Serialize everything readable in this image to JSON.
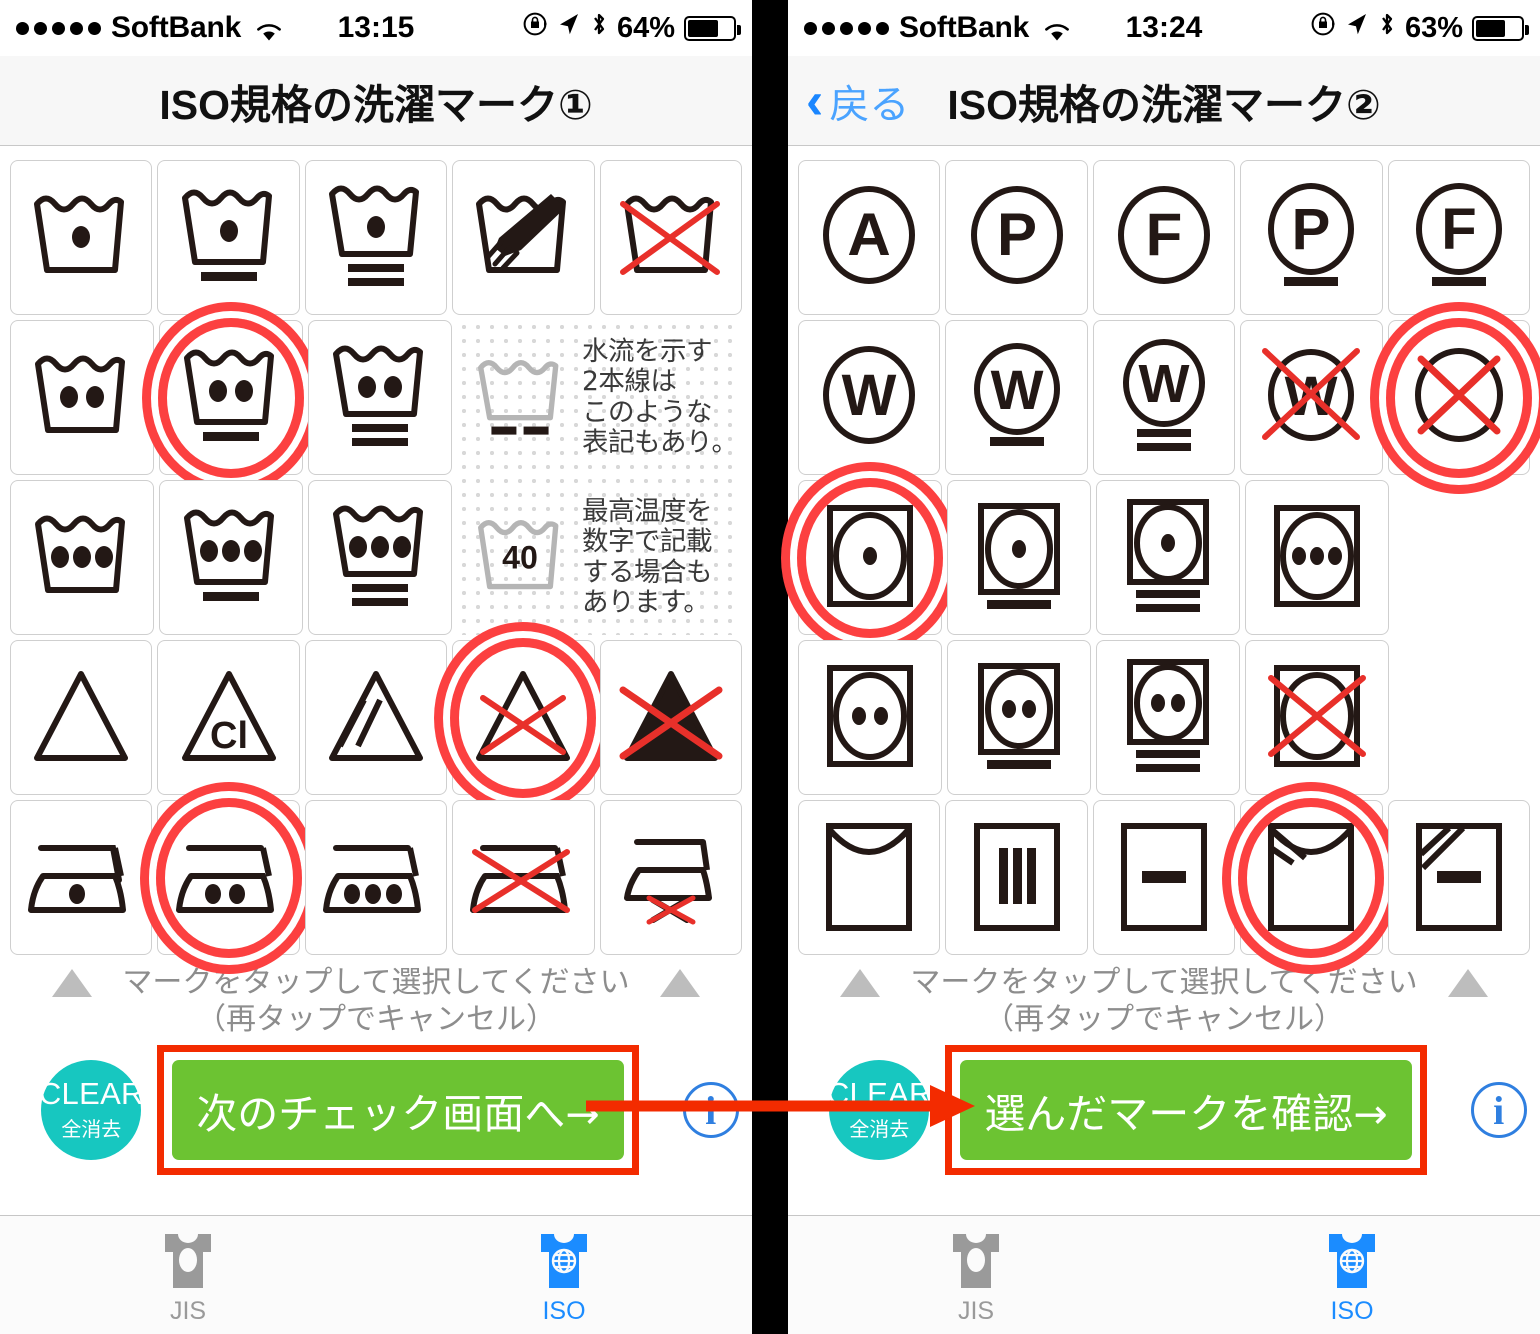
{
  "app": {
    "tabs": [
      {
        "id": "jis",
        "label": "JIS",
        "icon": "tshirt-icon",
        "active": false
      },
      {
        "id": "iso",
        "label": "ISO",
        "icon": "tshirt-globe-icon",
        "active": true
      }
    ],
    "colors": {
      "selection_ring": "#fc4040",
      "clear_button": "#17c7c0",
      "primary_button": "#6cc332",
      "highlight_box": "#f32b00",
      "active_tab": "#1b8cff",
      "inactive_tab": "#9a9a9a",
      "back_link": "#4aa3ff",
      "info_icon": "#2f7fe0"
    }
  },
  "screens": [
    {
      "id": "screen-1",
      "status_bar": {
        "signal_dots": 5,
        "carrier": "SoftBank",
        "wifi_icon": "wifi-icon",
        "time": "13:15",
        "lock_icon": "rotation-lock-icon",
        "location_icon": "location-arrow-icon",
        "bluetooth_icon": "bluetooth-icon",
        "battery_percent": "64%",
        "battery_level": 64
      },
      "nav": {
        "title": "ISO規格の洗濯マーク①",
        "has_back": false,
        "back_label": ""
      },
      "grid": {
        "rows": [
          {
            "cells": [
              {
                "name": "wash-normal-1dot",
                "icon": "wash-tub-1dot",
                "selected": false
              },
              {
                "name": "wash-mild-1dot",
                "icon": "wash-tub-1dot-1bar",
                "selected": false
              },
              {
                "name": "wash-very-mild-1dot",
                "icon": "wash-tub-1dot-2bar",
                "selected": false
              },
              {
                "name": "hand-wash",
                "icon": "wash-tub-hand",
                "selected": false
              },
              {
                "name": "do-not-wash",
                "icon": "wash-tub-crossed",
                "selected": false
              }
            ]
          },
          {
            "cells": [
              {
                "name": "wash-normal-2dot",
                "icon": "wash-tub-2dot",
                "selected": false
              },
              {
                "name": "wash-mild-2dot",
                "icon": "wash-tub-2dot-1bar",
                "selected": true
              },
              {
                "name": "wash-very-mild-2dot",
                "icon": "wash-tub-2dot-2bar",
                "selected": false
              }
            ],
            "annotation": {
              "items": [
                {
                  "icon": "wash-tub-2bar-gray",
                  "text": "水流を示す\n2本線は\nこのような\n表記もあり。"
                },
                {
                  "icon": "wash-tub-40-gray",
                  "text": "最高温度を\n数字で記載\nする場合も\nあります。",
                  "number": "40"
                }
              ]
            }
          },
          {
            "cells": [
              {
                "name": "wash-normal-3dot",
                "icon": "wash-tub-3dot",
                "selected": false
              },
              {
                "name": "wash-mild-3dot",
                "icon": "wash-tub-3dot-1bar",
                "selected": false
              },
              {
                "name": "wash-very-mild-3dot",
                "icon": "wash-tub-3dot-2bar",
                "selected": false
              }
            ]
          },
          {
            "cells": [
              {
                "name": "bleach-any",
                "icon": "triangle-plain",
                "selected": false
              },
              {
                "name": "bleach-chlorine",
                "icon": "triangle-cl",
                "label": "Cl",
                "selected": false
              },
              {
                "name": "bleach-non-chlorine",
                "icon": "triangle-diagonal-lines",
                "selected": false
              },
              {
                "name": "do-not-bleach",
                "icon": "triangle-crossed",
                "selected": true
              },
              {
                "name": "do-not-bleach-filled",
                "icon": "triangle-filled-crossed",
                "selected": false
              }
            ]
          },
          {
            "cells": [
              {
                "name": "iron-low",
                "icon": "iron-1dot",
                "selected": false
              },
              {
                "name": "iron-medium",
                "icon": "iron-2dot",
                "selected": true
              },
              {
                "name": "iron-high",
                "icon": "iron-3dot",
                "selected": false
              },
              {
                "name": "do-not-iron",
                "icon": "iron-crossed",
                "selected": false
              },
              {
                "name": "no-steam-iron",
                "icon": "iron-no-steam",
                "selected": false
              }
            ]
          }
        ]
      },
      "instructions": {
        "line1": "マークをタップして選択してください",
        "line2": "（再タップでキャンセル）",
        "left_marker_icon": "triangle-up-icon",
        "right_marker_icon": "triangle-up-icon"
      },
      "actions": {
        "clear_label": "CLEAR",
        "clear_sub_label": "全消去",
        "primary_label": "次のチェック画面へ→",
        "info_label": "i",
        "primary_highlighted": true
      }
    },
    {
      "id": "screen-2",
      "status_bar": {
        "signal_dots": 5,
        "carrier": "SoftBank",
        "wifi_icon": "wifi-icon",
        "time": "13:24",
        "lock_icon": "rotation-lock-icon",
        "location_icon": "location-arrow-icon",
        "bluetooth_icon": "bluetooth-icon",
        "battery_percent": "63%",
        "battery_level": 63
      },
      "nav": {
        "title": "ISO規格の洗濯マーク②",
        "has_back": true,
        "back_label": "戻る"
      },
      "grid": {
        "rows": [
          {
            "cells": [
              {
                "name": "dryclean-any-solvent",
                "icon": "circle-letter",
                "label": "A",
                "selected": false
              },
              {
                "name": "dryclean-perchloro",
                "icon": "circle-letter",
                "label": "P",
                "selected": false
              },
              {
                "name": "dryclean-hydrocarbon",
                "icon": "circle-letter",
                "label": "F",
                "selected": false
              },
              {
                "name": "dryclean-perchloro-mild",
                "icon": "circle-letter-1bar",
                "label": "P",
                "selected": false
              },
              {
                "name": "dryclean-hydrocarbon-mild",
                "icon": "circle-letter-1bar",
                "label": "F",
                "selected": false
              }
            ]
          },
          {
            "cells": [
              {
                "name": "wetclean-normal",
                "icon": "circle-letter",
                "label": "W",
                "selected": false
              },
              {
                "name": "wetclean-mild",
                "icon": "circle-letter-1bar",
                "label": "W",
                "selected": false
              },
              {
                "name": "wetclean-very-mild",
                "icon": "circle-letter-2bar",
                "label": "W",
                "selected": false
              },
              {
                "name": "do-not-wetclean",
                "icon": "circle-letter-crossed",
                "label": "W",
                "selected": false
              },
              {
                "name": "do-not-dryclean",
                "icon": "circle-crossed",
                "selected": true
              }
            ]
          },
          {
            "cells": [
              {
                "name": "tumble-dry-low",
                "icon": "tumble-1dot",
                "selected": true
              },
              {
                "name": "tumble-dry-low-mild",
                "icon": "tumble-1dot-1bar",
                "selected": false
              },
              {
                "name": "tumble-dry-low-very-mild",
                "icon": "tumble-1dot-2bar",
                "selected": false
              },
              {
                "name": "tumble-dry-3dot",
                "icon": "tumble-3dot",
                "selected": false
              }
            ]
          },
          {
            "cells": [
              {
                "name": "tumble-dry-normal",
                "icon": "tumble-2dot",
                "selected": false
              },
              {
                "name": "tumble-dry-normal-mild",
                "icon": "tumble-2dot-1bar",
                "selected": false
              },
              {
                "name": "tumble-dry-normal-very-mild",
                "icon": "tumble-2dot-2bar",
                "selected": false
              },
              {
                "name": "do-not-tumble-dry",
                "icon": "tumble-crossed",
                "selected": false
              }
            ]
          },
          {
            "cells": [
              {
                "name": "line-dry",
                "icon": "square-curve",
                "selected": false
              },
              {
                "name": "drip-dry",
                "icon": "square-3lines",
                "selected": false
              },
              {
                "name": "flat-dry",
                "icon": "square-1line",
                "selected": false
              },
              {
                "name": "line-dry-shade",
                "icon": "square-curve-shade",
                "selected": true
              },
              {
                "name": "flat-dry-shade",
                "icon": "square-1line-shade",
                "selected": false
              }
            ]
          }
        ]
      },
      "instructions": {
        "line1": "マークをタップして選択してください",
        "line2": "（再タップでキャンセル）",
        "left_marker_icon": "triangle-up-icon",
        "right_marker_icon": "triangle-up-icon"
      },
      "actions": {
        "clear_label": "CLEAR",
        "clear_sub_label": "全消去",
        "primary_label": "選んだマークを確認→",
        "info_label": "i",
        "primary_highlighted": true
      }
    }
  ],
  "annotation_arrow": {
    "name": "red-flow-arrow",
    "color": "#f32b00",
    "from": "screen-1 primary button",
    "to": "screen-2 primary button"
  }
}
